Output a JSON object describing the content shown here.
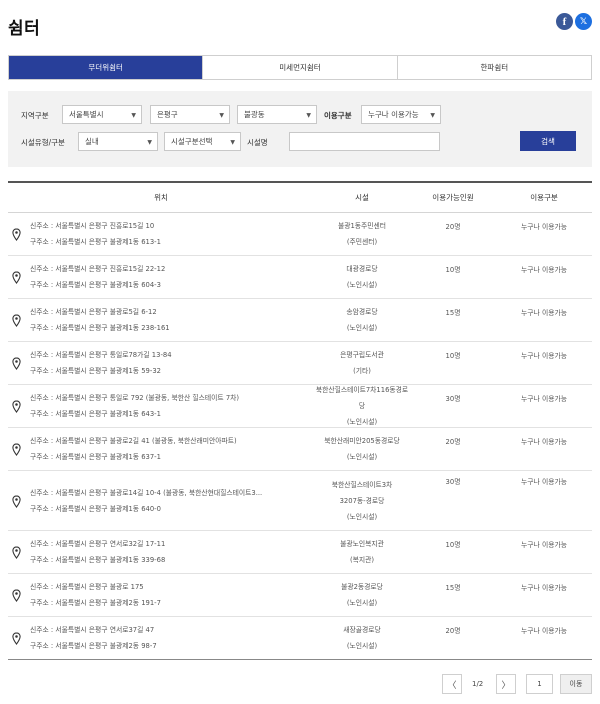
{
  "page": {
    "title": "쉼터"
  },
  "share": {
    "facebook": "f",
    "twitter": "𝕏"
  },
  "tabs": [
    {
      "label": "무더위쉼터",
      "active": true
    },
    {
      "label": "미세먼지쉼터",
      "active": false
    },
    {
      "label": "한파쉼터",
      "active": false
    }
  ],
  "filter": {
    "region_label": "지역구분",
    "city": "서울특별시",
    "district": "은평구",
    "dong": "불광동",
    "use_label": "이용구분",
    "use_value": "누구나 이용가능",
    "type_label": "시설유형/구분",
    "type_value": "실내",
    "category_value": "시설구분선택",
    "name_label": "시설명",
    "name_value": "",
    "search_button": "검색"
  },
  "table": {
    "headers": [
      "위치",
      "시설",
      "이용가능인원",
      "이용구분"
    ],
    "rows": [
      {
        "new": "신주소 : 서울특별시 은평구 진흥로15길 10",
        "old": "구주소 : 서울특별시 은평구 불광제1동 613-1",
        "facility": [
          "불광1동주민센터",
          "(주민센터)"
        ],
        "capacity": "20명",
        "use": "누구나 이용가능"
      },
      {
        "new": "신주소 : 서울특별시 은평구 진흥로15길 22-12",
        "old": "구주소 : 서울특별시 은평구 불광제1동 604-3",
        "facility": [
          "대광경로당",
          "(노인시설)"
        ],
        "capacity": "10명",
        "use": "누구나 이용가능"
      },
      {
        "new": "신주소 : 서울특별시 은평구 불광로5길 6-12",
        "old": "구주소 : 서울특별시 은평구 불광제1동 238-161",
        "facility": [
          "송암경로당",
          "(노인시설)"
        ],
        "capacity": "15명",
        "use": "누구나 이용가능"
      },
      {
        "new": "신주소 : 서울특별시 은평구 통일로78가길 13-84",
        "old": "구주소 : 서울특별시 은평구 불광제1동 59-32",
        "facility": [
          "은평구립도서관",
          "(기타)"
        ],
        "capacity": "10명",
        "use": "누구나 이용가능"
      },
      {
        "new": "신주소 : 서울특별시 은평구 통일로 792 (불광동, 북한산 힐스테이트 7차)",
        "old": "구주소 : 서울특별시 은평구 불광제1동 643-1",
        "facility": [
          "북한산힐스테이트7차116동경로당",
          "(노인시설)"
        ],
        "capacity": "30명",
        "use": "누구나 이용가능"
      },
      {
        "new": "신주소 : 서울특별시 은평구 불광로2길 41 (불광동, 북한산래미안아파트)",
        "old": "구주소 : 서울특별시 은평구 불광제1동 637-1",
        "facility": [
          "북한산래미안205동경로당",
          "(노인시설)"
        ],
        "capacity": "20명",
        "use": "누구나 이용가능"
      },
      {
        "new": "신주소 : 서울특별시 은평구 불광로14길 10-4 (불광동, 북한산현대힐스테이트3...",
        "old": "구주소 : 서울특별시 은평구 불광제1동 640-0",
        "facility": [
          "북한산힐스테이트3차",
          "3207동-경로당",
          "(노인시설)"
        ],
        "capacity": "30명",
        "use": "누구나 이용가능"
      },
      {
        "new": "신주소 : 서울특별시 은평구 연서로32길 17-11",
        "old": "구주소 : 서울특별시 은평구 불광제1동 339-68",
        "facility": [
          "불광노인복지관",
          "(복지관)"
        ],
        "capacity": "10명",
        "use": "누구나 이용가능"
      },
      {
        "new": "신주소 : 서울특별시 은평구 불광로 175",
        "old": "구주소 : 서울특별시 은평구 불광제2동 191-7",
        "facility": [
          "불광2동경로당",
          "(노인시설)"
        ],
        "capacity": "15명",
        "use": "누구나 이용가능"
      },
      {
        "new": "신주소 : 서울특별시 은평구 연서로37길 47",
        "old": "구주소 : 서울특별시 은평구 불광제2동 98-7",
        "facility": [
          "새장골경로당",
          "(노인시설)"
        ],
        "capacity": "20명",
        "use": "누구나 이용가능"
      }
    ]
  },
  "pagination": {
    "prev": "〈",
    "info": "1/2",
    "next": "〉",
    "page_input": "1",
    "go_button": "이동"
  }
}
